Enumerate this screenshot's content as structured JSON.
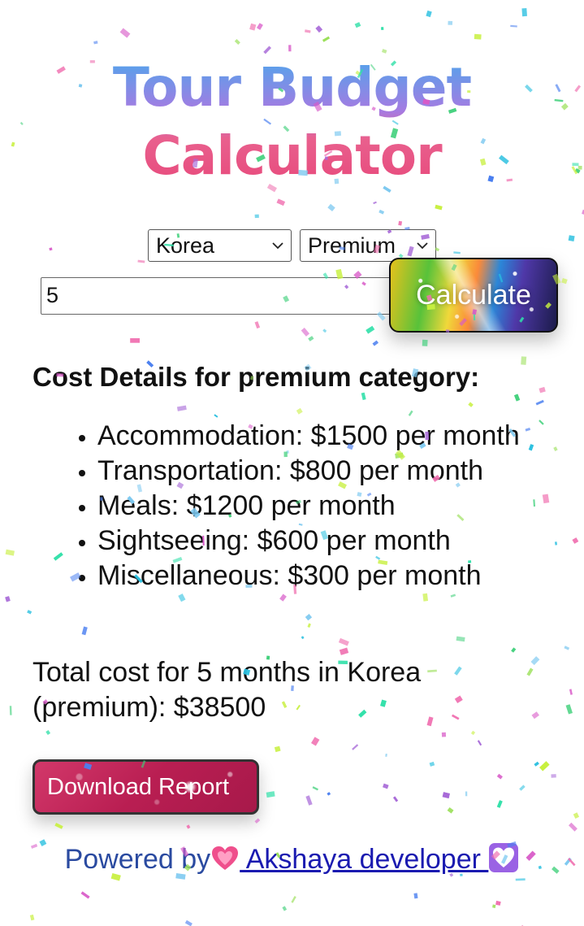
{
  "title": {
    "line1": "Tour Budget",
    "line2": "Calculator"
  },
  "form": {
    "country": {
      "selected": "Korea"
    },
    "category": {
      "selected": "Premium"
    },
    "months_value": "5",
    "calculate_label": "Calculate"
  },
  "results": {
    "heading": "Cost Details for premium category:",
    "items": [
      "Accommodation: $1500 per month",
      "Transportation: $800 per month",
      "Meals: $1200 per month",
      "Sightseeing: $600 per month",
      "Miscellaneous: $300 per month"
    ],
    "total": "Total cost for 5 months in Korea (premium): $38500"
  },
  "download_label": "Download Report",
  "footer": {
    "prefix": "Powered by",
    "link_text": " Akshaya developer "
  },
  "colors": {
    "title_top": "#4aa8ec",
    "title_bottom": "#e7487a",
    "download_button": "#c02456",
    "footer_text": "#2a4aa0",
    "link": "#1a1ab0"
  }
}
